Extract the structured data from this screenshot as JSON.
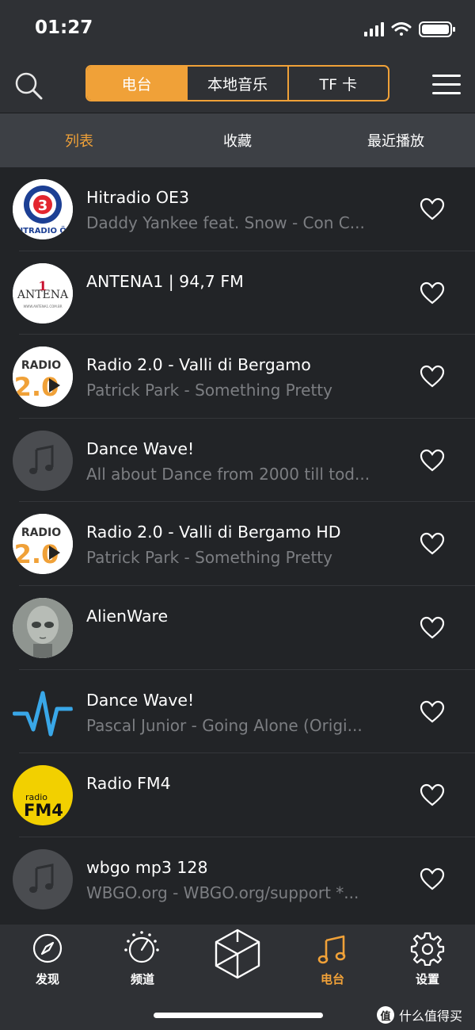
{
  "status": {
    "time": "01:27"
  },
  "segments": [
    {
      "label": "电台",
      "active": true
    },
    {
      "label": "本地音乐",
      "active": false
    },
    {
      "label": "TF 卡",
      "active": false
    }
  ],
  "subtabs": [
    {
      "label": "列表",
      "active": true
    },
    {
      "label": "收藏",
      "active": false
    },
    {
      "label": "最近播放",
      "active": false
    }
  ],
  "stations": [
    {
      "title": "Hitradio OE3",
      "subtitle": "Daddy Yankee feat. Snow - Con C...",
      "logo": "oe3-logo"
    },
    {
      "title": "ANTENA1 | 94,7 FM",
      "subtitle": "",
      "logo": "antena1-logo",
      "logo_text": "ANTENA",
      "logo_num": "1",
      "logo_small": "WWW.ANTENA1.COM.BR"
    },
    {
      "title": "Radio 2.0 - Valli di Bergamo",
      "subtitle": "Patrick Park - Something Pretty",
      "logo": "radio20-logo"
    },
    {
      "title": "Dance Wave!",
      "subtitle": "All about Dance from 2000 till tod...",
      "logo": "music-note-placeholder"
    },
    {
      "title": "Radio 2.0 - Valli di Bergamo HD",
      "subtitle": "Patrick Park - Something Pretty",
      "logo": "radio20-logo"
    },
    {
      "title": "AlienWare",
      "subtitle": "",
      "logo": "alien-logo"
    },
    {
      "title": "Dance Wave!",
      "subtitle": "Pascal Junior - Going Alone (Origi...",
      "logo": "dancewave-logo"
    },
    {
      "title": "Radio FM4",
      "subtitle": "",
      "logo": "fm4-logo"
    },
    {
      "title": "wbgo mp3 128",
      "subtitle": "WBGO.org - WBGO.org/support *...",
      "logo": "music-note-placeholder"
    }
  ],
  "nav": [
    {
      "label": "发现",
      "icon": "compass-icon"
    },
    {
      "label": "频道",
      "icon": "dial-icon"
    },
    {
      "label": "",
      "icon": "cube-icon"
    },
    {
      "label": "电台",
      "icon": "music-note-icon",
      "active": true
    },
    {
      "label": "设置",
      "icon": "gear-icon"
    }
  ],
  "watermark": {
    "badge": "值",
    "text": "什么值得买"
  },
  "colors": {
    "accent": "#f0a138",
    "background": "#222427",
    "bar": "#2f3135",
    "subtabs": "#3d4045",
    "subtitle": "#7c7e82"
  }
}
